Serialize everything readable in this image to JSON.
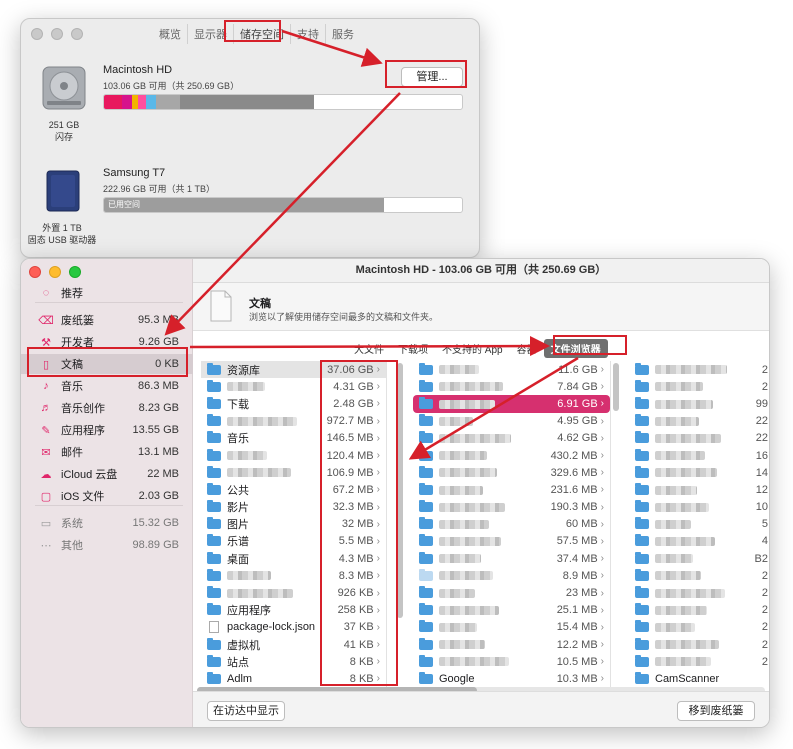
{
  "prefs": {
    "tabs": [
      "概览",
      "显示器",
      "储存空间",
      "支持",
      "服务"
    ],
    "active_tab": 2,
    "disks": [
      {
        "name": "Macintosh HD",
        "sub": "103.06 GB 可用（共 250.69 GB）",
        "caption1": "251 GB",
        "caption2": "闪存",
        "button": "管理..."
      },
      {
        "name": "Samsung T7",
        "sub": "222.96 GB 可用（共 1 TB）",
        "bar_label": "已用空间",
        "caption1": "外置 1 TB",
        "caption2": "固态 USB 驱动器"
      }
    ],
    "bar_colors": [
      "#e8185e",
      "#d6138c",
      "#f2b400",
      "#ff4f9e",
      "#5ab8e8",
      "#a7a7a7",
      "#8a8a8a"
    ]
  },
  "manager": {
    "title": "Macintosh HD - 103.06 GB 可用（共 250.69 GB）",
    "sidebar": [
      {
        "icon": "lightbulb-icon",
        "glyph": "◌",
        "label": "推荐",
        "size": ""
      },
      {
        "icon": "trash-icon",
        "glyph": "⌫",
        "label": "废纸篓",
        "size": "95.3 MB"
      },
      {
        "icon": "hammer-icon",
        "glyph": "⚒",
        "label": "开发者",
        "size": "9.26 GB"
      },
      {
        "icon": "document-icon",
        "glyph": "▯",
        "label": "文稿",
        "size": "0 KB"
      },
      {
        "icon": "music-icon",
        "glyph": "♪",
        "label": "音乐",
        "size": "86.3 MB"
      },
      {
        "icon": "music-creation-icon",
        "glyph": "♬",
        "label": "音乐创作",
        "size": "8.23 GB"
      },
      {
        "icon": "apps-icon",
        "glyph": "✎",
        "label": "应用程序",
        "size": "13.55 GB"
      },
      {
        "icon": "mail-icon",
        "glyph": "✉",
        "label": "邮件",
        "size": "13.1 MB"
      },
      {
        "icon": "cloud-icon",
        "glyph": "☁",
        "label": "iCloud 云盘",
        "size": "22 MB"
      },
      {
        "icon": "ios-device-icon",
        "glyph": "▢",
        "label": "iOS 文件",
        "size": "2.03 GB"
      },
      {
        "icon": "laptop-icon",
        "glyph": "▭",
        "label": "系统",
        "size": "15.32 GB"
      },
      {
        "icon": "ellipsis-icon",
        "glyph": "⋯",
        "label": "其他",
        "size": "98.89 GB"
      }
    ],
    "header_title": "文稿",
    "header_desc": "浏览以了解使用储存空间最多的文稿和文件夹。",
    "seg_tabs": [
      "大文件",
      "下载项",
      "不支持的 App",
      "容器",
      "文件浏览器"
    ],
    "col1": [
      {
        "name": "资源库",
        "size": "37.06 GB"
      },
      {
        "name": "",
        "size": "4.31 GB"
      },
      {
        "name": "下载",
        "size": "2.48 GB"
      },
      {
        "name": "",
        "size": "972.7 MB"
      },
      {
        "name": "音乐",
        "size": "146.5 MB"
      },
      {
        "name": "",
        "size": "120.4 MB"
      },
      {
        "name": "",
        "size": "106.9 MB"
      },
      {
        "name": "公共",
        "size": "67.2 MB"
      },
      {
        "name": "影片",
        "size": "32.3 MB"
      },
      {
        "name": "图片",
        "size": "32 MB"
      },
      {
        "name": "乐谱",
        "size": "5.5 MB"
      },
      {
        "name": "桌面",
        "size": "4.3 MB"
      },
      {
        "name": "",
        "size": "8.3 MB"
      },
      {
        "name": "",
        "size": "926 KB"
      },
      {
        "name": "应用程序",
        "size": "258 KB"
      },
      {
        "name": "package-lock.json",
        "size": "37 KB"
      },
      {
        "name": "虚拟机",
        "size": "41 KB"
      },
      {
        "name": "站点",
        "size": "8 KB"
      },
      {
        "name": "Adlm",
        "size": "8 KB"
      }
    ],
    "col2": [
      {
        "name": "",
        "size": "11.6 GB"
      },
      {
        "name": "",
        "size": "7.84 GB"
      },
      {
        "name": "",
        "size": "6.91 GB"
      },
      {
        "name": "",
        "size": "4.95 GB"
      },
      {
        "name": "",
        "size": "4.62 GB"
      },
      {
        "name": "",
        "size": "430.2 MB"
      },
      {
        "name": "",
        "size": "329.6 MB"
      },
      {
        "name": "",
        "size": "231.6 MB"
      },
      {
        "name": "",
        "size": "190.3 MB"
      },
      {
        "name": "",
        "size": "60 MB"
      },
      {
        "name": "",
        "size": "57.5 MB"
      },
      {
        "name": "",
        "size": "37.4 MB"
      },
      {
        "name": "",
        "size": "8.9 MB"
      },
      {
        "name": "",
        "size": "23 MB"
      },
      {
        "name": "",
        "size": "25.1 MB"
      },
      {
        "name": "",
        "size": "15.4 MB"
      },
      {
        "name": "",
        "size": "12.2 MB"
      },
      {
        "name": "",
        "size": "10.5 MB"
      },
      {
        "name": "Google",
        "size": "10.3 MB"
      }
    ],
    "col3": [
      {
        "name": "",
        "size": "2"
      },
      {
        "name": "",
        "size": "2"
      },
      {
        "name": "",
        "size": "99"
      },
      {
        "name": "",
        "size": "22"
      },
      {
        "name": "",
        "size": "22"
      },
      {
        "name": "",
        "size": "16"
      },
      {
        "name": "",
        "size": "14"
      },
      {
        "name": "",
        "size": "12"
      },
      {
        "name": "",
        "size": "10"
      },
      {
        "name": "",
        "size": "5"
      },
      {
        "name": "",
        "size": "4"
      },
      {
        "name": "",
        "size": "B2"
      },
      {
        "name": "",
        "size": "2"
      },
      {
        "name": "",
        "size": "2"
      },
      {
        "name": "",
        "size": "2"
      },
      {
        "name": "",
        "size": "2"
      },
      {
        "name": "",
        "size": "2"
      },
      {
        "name": "",
        "size": "2"
      },
      {
        "name": "CamScanner",
        "size": ""
      }
    ],
    "show_in_finder": "在访达中显示",
    "move_to_trash": "移到废纸篓"
  }
}
